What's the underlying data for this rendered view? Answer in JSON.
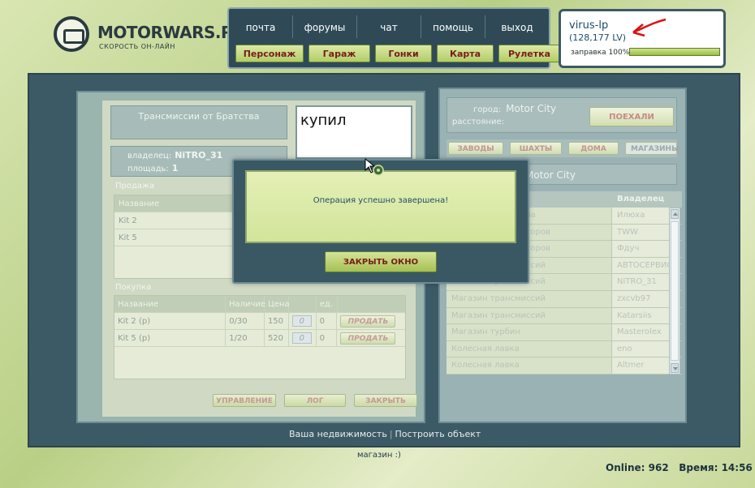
{
  "site": {
    "logo_text": "MOTORWARS.RU",
    "logo_sub": "СКОРОСТЬ ОН-ЛАЙН"
  },
  "topnav": {
    "links": [
      "почта",
      "форумы",
      "чат",
      "помощь",
      "выход"
    ],
    "buttons": [
      "Персонаж",
      "Гараж",
      "Гонки",
      "Карта",
      "Рулетка"
    ]
  },
  "user": {
    "name": "virus-lp",
    "level": "(128,177 LV)",
    "refill_label": "заправка 100%",
    "refill_percent": 100
  },
  "left": {
    "title": "Трансмиссии от Братства",
    "note": "купил",
    "owner_label": "владелец:",
    "owner_value": "NiTRO_31",
    "area_label": "площадь:",
    "area_value": "1",
    "sale_label": "Продажа",
    "sale_header": "Название",
    "sale_items": [
      "Kit 2",
      "Kit 5"
    ],
    "buy_label": "Покупка",
    "buy_headers": [
      "Название",
      "Наличие",
      "Цена",
      "",
      "ед."
    ],
    "buy_rows": [
      {
        "name": "Kit 2 (р)",
        "stock": "0/30",
        "price": "150",
        "qty": "0",
        "unit": "0",
        "action": "ПРОДАТЬ"
      },
      {
        "name": "Kit 5 (р)",
        "stock": "1/20",
        "price": "520",
        "qty": "0",
        "unit": "0",
        "action": "ПРОДАТЬ"
      }
    ],
    "footer_buttons": [
      "УПРАВЛЕНИЕ",
      "ЛОГ",
      "ЗАКРЫТЬ"
    ]
  },
  "right": {
    "city_label": "город:",
    "city_value": "Motor City",
    "distance_label": "расстояние:",
    "go_button": "ПОЕХАЛИ",
    "tabs": [
      "ЗАВОДЫ",
      "ШАХТЫ",
      "ДОМА",
      "МАГАЗИНЫ"
    ],
    "city_heading": "Motor City",
    "owner_header": "Владелец",
    "shops": [
      {
        "name": "Магазин автохлама",
        "owner": "Илюха"
      },
      {
        "name": "Магазин компрессоров",
        "owner": "TWW"
      },
      {
        "name": "Магазин компрессоров",
        "owner": "Фдуч"
      },
      {
        "name": "Магазин трансмиссий",
        "owner": "АВТОСЕРВИС"
      },
      {
        "name": "Магазин трансмиссий",
        "owner": "NiTRO_31"
      },
      {
        "name": "Магазин трансмиссий",
        "owner": "zxcvb97"
      },
      {
        "name": "Магазин трансмиссий",
        "owner": "Katarsiis"
      },
      {
        "name": "Магазин турбин",
        "owner": "Masterolex"
      },
      {
        "name": "Колесная лавка",
        "owner": "eno"
      },
      {
        "name": "Колесная лавка",
        "owner": "Altmer"
      }
    ]
  },
  "bottom": {
    "link1": "Ваша недвижимость",
    "separator": "|",
    "link2": "Построить объект",
    "caption": "магазин :)",
    "status": "Online: 962   Время: 14:56"
  },
  "modal": {
    "message": "Операция успешно завершена!",
    "close_button": "ЗАКРЫТЬ ОКНО"
  }
}
